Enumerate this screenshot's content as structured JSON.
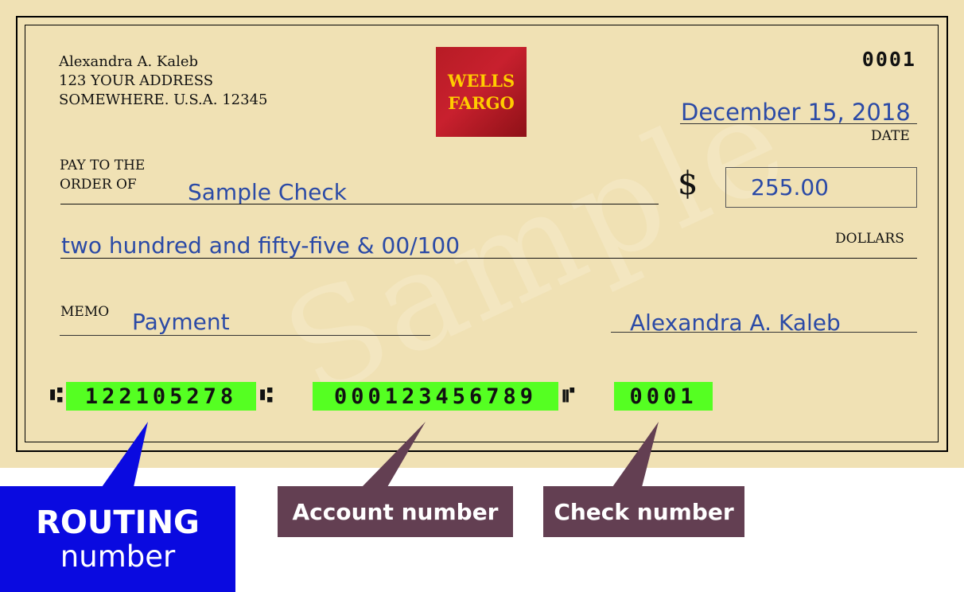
{
  "check": {
    "owner": {
      "name": "Alexandra A. Kaleb",
      "address_line1": "123 YOUR ADDRESS",
      "address_line2": "SOMEWHERE. U.S.A. 12345"
    },
    "bank_logo": {
      "line1": "WELLS",
      "line2": "FARGO",
      "bg_color": "#c01f2b",
      "text_color": "#ffcc00"
    },
    "check_number": "0001",
    "date": {
      "value": "December 15, 2018",
      "label": "DATE"
    },
    "pay_to": {
      "label_line1": "PAY TO THE",
      "label_line2": "ORDER OF",
      "payee": "Sample Check"
    },
    "amount": {
      "currency_symbol": "$",
      "value": "255.00"
    },
    "amount_words": {
      "value": "two hundred and fifty-five & 00/100",
      "label": "DOLLARS"
    },
    "memo": {
      "label": "MEMO",
      "value": "Payment"
    },
    "signature": "Alexandra A. Kaleb",
    "watermark": "Sample",
    "micr": {
      "routing": "122105278",
      "account": "000123456789",
      "check": "0001",
      "transit_symbol": "⑆",
      "onus_symbol": "⑈",
      "highlight_color": "#55ff22"
    }
  },
  "callouts": {
    "routing": {
      "line1": "ROUTING",
      "line2": "number",
      "color": "#0a0ae0"
    },
    "account": {
      "label": "Account number",
      "color": "#633f52"
    },
    "check": {
      "label": "Check number",
      "color": "#633f52"
    }
  },
  "colors": {
    "paper": "#f0e1b4",
    "ink": "#2b4aa6"
  }
}
